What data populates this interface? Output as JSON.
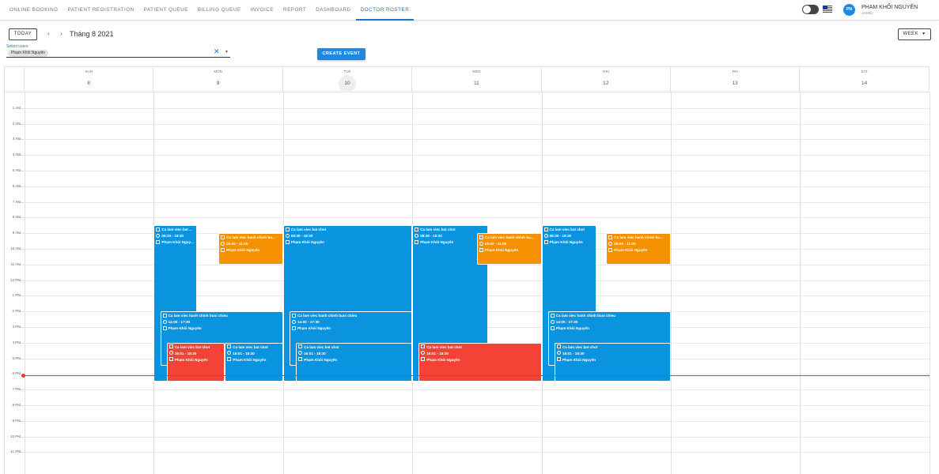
{
  "nav": {
    "tabs": [
      "ONLINE BOOKING",
      "PATIENT REGISTRATION",
      "PATIENT QUEUE",
      "BILLING QUEUE",
      "INVOICE",
      "REPORT",
      "DASHBOARD",
      "DOCTOR ROSTER"
    ],
    "active_tab": "DOCTOR ROSTER",
    "user": {
      "initials": "PN",
      "name": "PHAM KHỐI NGUYÊN",
      "role": "ADMIN"
    }
  },
  "toolbar": {
    "today_label": "TODAY",
    "prev_icon": "‹",
    "next_icon": "›",
    "month_title": "Tháng 8 2021",
    "view_label": "WEEK",
    "view_caret": "▼",
    "select_label": "Select users",
    "selected_user_chip": "Phạm Khôi Nguyên",
    "clear_icon": "✕",
    "dropdown_icon": "▼",
    "create_event_label": "CREATE EVENT"
  },
  "calendar": {
    "days": [
      {
        "dow": "SUN",
        "date": "8"
      },
      {
        "dow": "MON",
        "date": "9"
      },
      {
        "dow": "TUE",
        "date": "10"
      },
      {
        "dow": "WED",
        "date": "11"
      },
      {
        "dow": "THU",
        "date": "12"
      },
      {
        "dow": "FRI",
        "date": "13"
      },
      {
        "dow": "SAT",
        "date": "14"
      }
    ],
    "today_index": 2,
    "hour_labels": [
      "1 AM",
      "2 AM",
      "3 AM",
      "4 AM",
      "5 AM",
      "6 AM",
      "7 AM",
      "8 AM",
      "9 AM",
      "10 AM",
      "11 AM",
      "12 PM",
      "1 PM",
      "2 PM",
      "3 PM",
      "4 PM",
      "5 PM",
      "6 PM",
      "7 PM",
      "8 PM",
      "9 PM",
      "10 PM",
      "11 PM"
    ],
    "current_time_hour": 18.15,
    "events": [
      {
        "day": 1,
        "start": 8.5,
        "end": 18.5,
        "col": 0,
        "of": 3.0,
        "span": 1.0,
        "color": "#0a94e0",
        "title": "Ca lam viec bat ...",
        "time": "08:30 - 18:30",
        "doctor": "Phạm Khôi Nguyên"
      },
      {
        "day": 1,
        "start": 9.0,
        "end": 11.0,
        "col": 1.5,
        "of": 3.0,
        "span": 1.5,
        "color": "#f59100",
        "title": "Ca lam viec hanh chinh bu...",
        "time": "09:00 - 11:00",
        "doctor": "Phạm Khôi Nguyên"
      },
      {
        "day": 1,
        "start": 14.0,
        "end": 17.5,
        "col": 0.15,
        "of": 3.0,
        "span": 2.85,
        "color": "#0a94e0",
        "title": "Ca lam viec hanh chinh buoi chieu",
        "time": "14:00 - 17:30",
        "doctor": "Phạm Khôi Nguyên"
      },
      {
        "day": 1,
        "start": 16.0,
        "end": 18.5,
        "col": 0.3,
        "of": 3.0,
        "span": 1.35,
        "color": "#f44336",
        "title": "Ca lam viec bat chot",
        "time": "16:01 - 18:30",
        "doctor": "Phạm Khôi Nguyên"
      },
      {
        "day": 1,
        "start": 16.0,
        "end": 18.5,
        "col": 1.65,
        "of": 3.0,
        "span": 1.35,
        "color": "#0a94e0",
        "title": "Ca lam viec bat chot",
        "time": "16:01 - 18:30",
        "doctor": "Phạm Khôi Nguyên"
      },
      {
        "day": 2,
        "start": 8.5,
        "end": 18.5,
        "col": 0,
        "of": 3.0,
        "span": 3.0,
        "color": "#0a94e0",
        "title": "Ca lam viec bat chot",
        "time": "08:30 - 18:30",
        "doctor": "Phạm Khôi Nguyên"
      },
      {
        "day": 2,
        "start": 14.0,
        "end": 17.5,
        "col": 0.15,
        "of": 3.0,
        "span": 2.85,
        "color": "#0a94e0",
        "title": "Ca lam viec hanh chinh buoi chieu",
        "time": "14:00 - 17:30",
        "doctor": "Phạm Khôi Nguyên"
      },
      {
        "day": 2,
        "start": 16.0,
        "end": 18.5,
        "col": 0.3,
        "of": 3.0,
        "span": 2.7,
        "color": "#0a94e0",
        "title": "Ca lam viec bat chot",
        "time": "16:01 - 18:30",
        "doctor": "Phạm Khôi Nguyên"
      },
      {
        "day": 3,
        "start": 8.5,
        "end": 18.5,
        "col": 0,
        "of": 3.0,
        "span": 1.75,
        "color": "#0a94e0",
        "title": "Ca lam viec bat chot",
        "time": "08:30 - 18:30",
        "doctor": "Phạm Khôi Nguyên"
      },
      {
        "day": 3,
        "start": 9.0,
        "end": 11.0,
        "col": 1.5,
        "of": 3.0,
        "span": 1.5,
        "color": "#f59100",
        "title": "Ca lam viec hanh chinh bu...",
        "time": "09:00 - 11:00",
        "doctor": "Phạm Khôi Nguyên"
      },
      {
        "day": 3,
        "start": 16.0,
        "end": 18.5,
        "col": 0.15,
        "of": 3.0,
        "span": 2.85,
        "color": "#f44336",
        "title": "Ca lam viec bat chot",
        "time": "16:01 - 18:30",
        "doctor": "Phạm Khôi Nguyên"
      },
      {
        "day": 4,
        "start": 8.5,
        "end": 18.5,
        "col": 0,
        "of": 3.0,
        "span": 1.28,
        "color": "#0a94e0",
        "title": "Ca lam viec bat chot",
        "time": "08:30 - 18:30",
        "doctor": "Phạm Khôi Nguyên"
      },
      {
        "day": 4,
        "start": 9.0,
        "end": 11.0,
        "col": 1.5,
        "of": 3.0,
        "span": 1.5,
        "color": "#f59100",
        "title": "Ca lam viec hanh chinh bu...",
        "time": "09:00 - 11:00",
        "doctor": "Phạm Khôi Nguyên"
      },
      {
        "day": 4,
        "start": 14.0,
        "end": 17.5,
        "col": 0.15,
        "of": 3.0,
        "span": 2.85,
        "color": "#0a94e0",
        "title": "Ca lam viec hanh chinh buoi chieu",
        "time": "14:00 - 17:30",
        "doctor": "Phạm Khôi Nguyên"
      },
      {
        "day": 4,
        "start": 16.0,
        "end": 18.5,
        "col": 0.3,
        "of": 3.0,
        "span": 2.7,
        "color": "#0a94e0",
        "title": "Ca lam viec bat chot",
        "time": "16:01 - 18:30",
        "doctor": "Phạm Khôi Nguyên"
      }
    ]
  }
}
